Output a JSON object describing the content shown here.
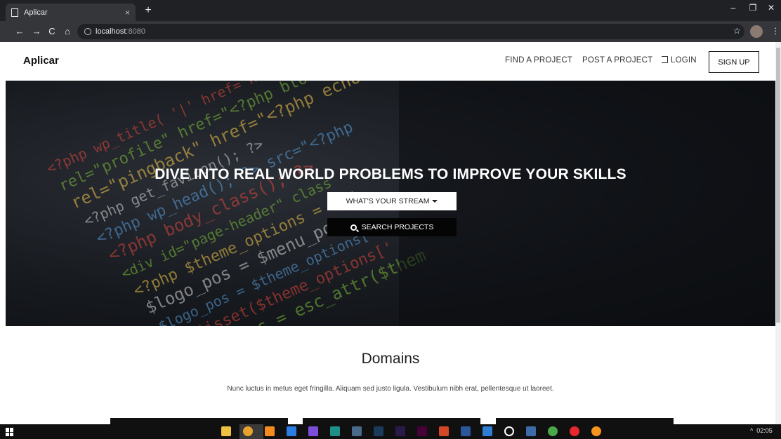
{
  "browser": {
    "tab_title": "Aplicar",
    "tab_close": "×",
    "new_tab": "+",
    "address_host": "localhost",
    "address_port": ":8080",
    "controls": {
      "back": "←",
      "forward": "→",
      "reload": "C",
      "home": "⌂",
      "star": "☆",
      "menu": "⋮",
      "minimize": "–",
      "restore": "❐",
      "close": "✕"
    }
  },
  "navbar": {
    "brand": "Aplicar",
    "links": {
      "find": "FIND A PROJECT",
      "post": "POST A PROJECT",
      "login": "LOGIN"
    },
    "signup": "SIGN UP"
  },
  "hero": {
    "title": "DIVE INTO REAL WORLD PROBLEMS TO IMPROVE YOUR SKILLS",
    "stream_button": "WHAT'S YOUR STREAM",
    "search_button": "SEARCH PROJECTS",
    "code_lines": [
      "<?php wp_title( '|' href=\"http://",
      "rel=\"profile\" href=\"<?php blo",
      "rel=\"pingback\" href=\"<?php echo",
      "<?php get_favicon(); ?>",
      "<?php wp_head(); ?>  src=\"<?php",
      "<?php body_class(); ?>",
      "<div id=\"page-header\" class",
      "<?php  $theme_options = fru",
      "$logo_pos = $menu_pos",
      "$logo_pos = $theme_options['lo",
      "if (isset($theme_options['",
      "$logo_pos = esc_attr($them"
    ]
  },
  "domains": {
    "title": "Domains",
    "text": "Nunc luctus in metus eget fringilla. Aliquam sed justo ligula. Vestibulum nibh erat, pellentesque ut laoreet."
  },
  "taskbar": {
    "clock": "02:05",
    "tray_arrow": "^",
    "apps": [
      {
        "name": "file-explorer-icon",
        "color": "#f0c040"
      },
      {
        "name": "chrome-icon",
        "color": "#e8a32c"
      },
      {
        "name": "sublime-icon",
        "color": "#f58b1f"
      },
      {
        "name": "app-blue-icon",
        "color": "#2a7de1"
      },
      {
        "name": "app-purple-icon",
        "color": "#7c4ddb"
      },
      {
        "name": "app-teal-icon",
        "color": "#1f8f8a"
      },
      {
        "name": "app-slate-icon",
        "color": "#4a6a8a"
      },
      {
        "name": "photoshop-icon",
        "color": "#1c3a5c"
      },
      {
        "name": "premiere-icon",
        "color": "#2a1a4a"
      },
      {
        "name": "xd-icon",
        "color": "#470137"
      },
      {
        "name": "powerpoint-icon",
        "color": "#d24726"
      },
      {
        "name": "word-icon",
        "color": "#2b579a"
      },
      {
        "name": "visual-studio-icon",
        "color": "#2d7dd2"
      },
      {
        "name": "ring-icon",
        "color": "#ffffff"
      },
      {
        "name": "app-steel-icon",
        "color": "#3d6ba8"
      },
      {
        "name": "app-green-icon",
        "color": "#49a84a"
      },
      {
        "name": "opera-icon",
        "color": "#e6282c"
      },
      {
        "name": "firefox-icon",
        "color": "#f7941d"
      }
    ]
  },
  "colors": {
    "code_red": "#e0473d",
    "code_green": "#7fbf3a",
    "code_yellow": "#f0c64a",
    "code_blue": "#5aa0e0",
    "code_white": "#d8d8d8"
  }
}
